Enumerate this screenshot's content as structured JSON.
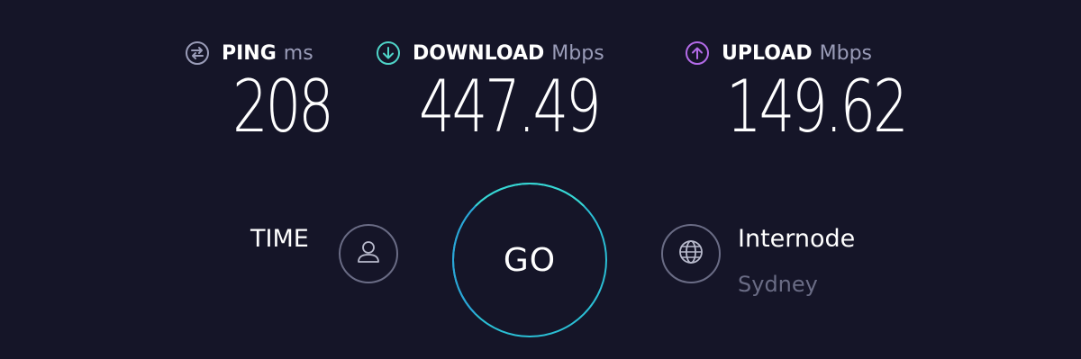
{
  "metrics": {
    "ping": {
      "label": "PING",
      "unit": "ms",
      "value": "208",
      "icon": "ping-icon",
      "color": "#9a9cb8"
    },
    "download": {
      "label": "DOWNLOAD",
      "unit": "Mbps",
      "value": "447.49",
      "icon": "download-arrow-icon",
      "color": "#4fd4c8"
    },
    "upload": {
      "label": "UPLOAD",
      "unit": "Mbps",
      "value": "149.62",
      "icon": "upload-arrow-icon",
      "color": "#b36be8"
    }
  },
  "connection": {
    "time_label": "TIME",
    "go_label": "GO",
    "isp_name": "Internode",
    "isp_location": "Sydney"
  },
  "colors": {
    "background": "#151528",
    "go_ring": "#2bbfd5",
    "muted": "#6a6c85"
  }
}
